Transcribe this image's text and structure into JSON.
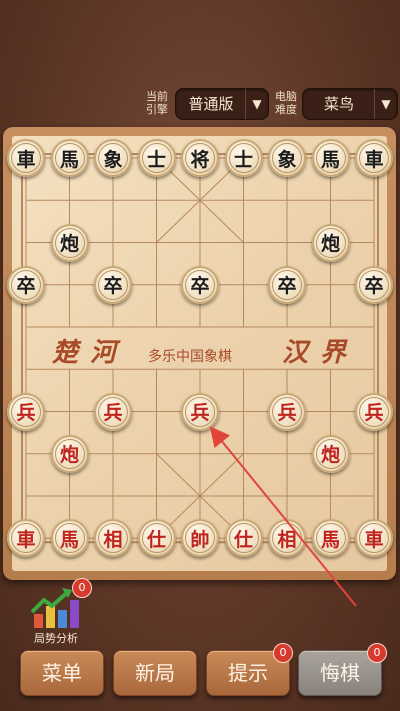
{
  "settings": {
    "engine_label": "当前引擎",
    "engine_value": "普通版",
    "level_label": "电脑难度",
    "level_value": "菜鸟"
  },
  "board": {
    "river_left": "楚河",
    "river_right": "汉界",
    "river_title": "多乐中国象棋",
    "pieces": [
      {
        "c": "black",
        "t": "車",
        "f": 0,
        "r": 0
      },
      {
        "c": "black",
        "t": "馬",
        "f": 1,
        "r": 0
      },
      {
        "c": "black",
        "t": "象",
        "f": 2,
        "r": 0
      },
      {
        "c": "black",
        "t": "士",
        "f": 3,
        "r": 0
      },
      {
        "c": "black",
        "t": "将",
        "f": 4,
        "r": 0
      },
      {
        "c": "black",
        "t": "士",
        "f": 5,
        "r": 0
      },
      {
        "c": "black",
        "t": "象",
        "f": 6,
        "r": 0
      },
      {
        "c": "black",
        "t": "馬",
        "f": 7,
        "r": 0
      },
      {
        "c": "black",
        "t": "車",
        "f": 8,
        "r": 0
      },
      {
        "c": "black",
        "t": "炮",
        "f": 1,
        "r": 2
      },
      {
        "c": "black",
        "t": "炮",
        "f": 7,
        "r": 2
      },
      {
        "c": "black",
        "t": "卒",
        "f": 0,
        "r": 3
      },
      {
        "c": "black",
        "t": "卒",
        "f": 2,
        "r": 3
      },
      {
        "c": "black",
        "t": "卒",
        "f": 4,
        "r": 3
      },
      {
        "c": "black",
        "t": "卒",
        "f": 6,
        "r": 3
      },
      {
        "c": "black",
        "t": "卒",
        "f": 8,
        "r": 3
      },
      {
        "c": "red",
        "t": "兵",
        "f": 0,
        "r": 6
      },
      {
        "c": "red",
        "t": "兵",
        "f": 2,
        "r": 6
      },
      {
        "c": "red",
        "t": "兵",
        "f": 4,
        "r": 6
      },
      {
        "c": "red",
        "t": "兵",
        "f": 6,
        "r": 6
      },
      {
        "c": "red",
        "t": "兵",
        "f": 8,
        "r": 6
      },
      {
        "c": "red",
        "t": "炮",
        "f": 1,
        "r": 7
      },
      {
        "c": "red",
        "t": "炮",
        "f": 7,
        "r": 7
      },
      {
        "c": "red",
        "t": "車",
        "f": 0,
        "r": 9
      },
      {
        "c": "red",
        "t": "馬",
        "f": 1,
        "r": 9
      },
      {
        "c": "red",
        "t": "相",
        "f": 2,
        "r": 9
      },
      {
        "c": "red",
        "t": "仕",
        "f": 3,
        "r": 9
      },
      {
        "c": "red",
        "t": "帥",
        "f": 4,
        "r": 9
      },
      {
        "c": "red",
        "t": "仕",
        "f": 5,
        "r": 9
      },
      {
        "c": "red",
        "t": "相",
        "f": 6,
        "r": 9
      },
      {
        "c": "red",
        "t": "馬",
        "f": 7,
        "r": 9
      },
      {
        "c": "red",
        "t": "車",
        "f": 8,
        "r": 9
      }
    ]
  },
  "analysis": {
    "label": "局势分析",
    "badge": "0"
  },
  "buttons": {
    "menu": "菜单",
    "new_game": "新局",
    "hint": "提示",
    "hint_badge": "0",
    "undo": "悔棋",
    "undo_badge": "0"
  }
}
